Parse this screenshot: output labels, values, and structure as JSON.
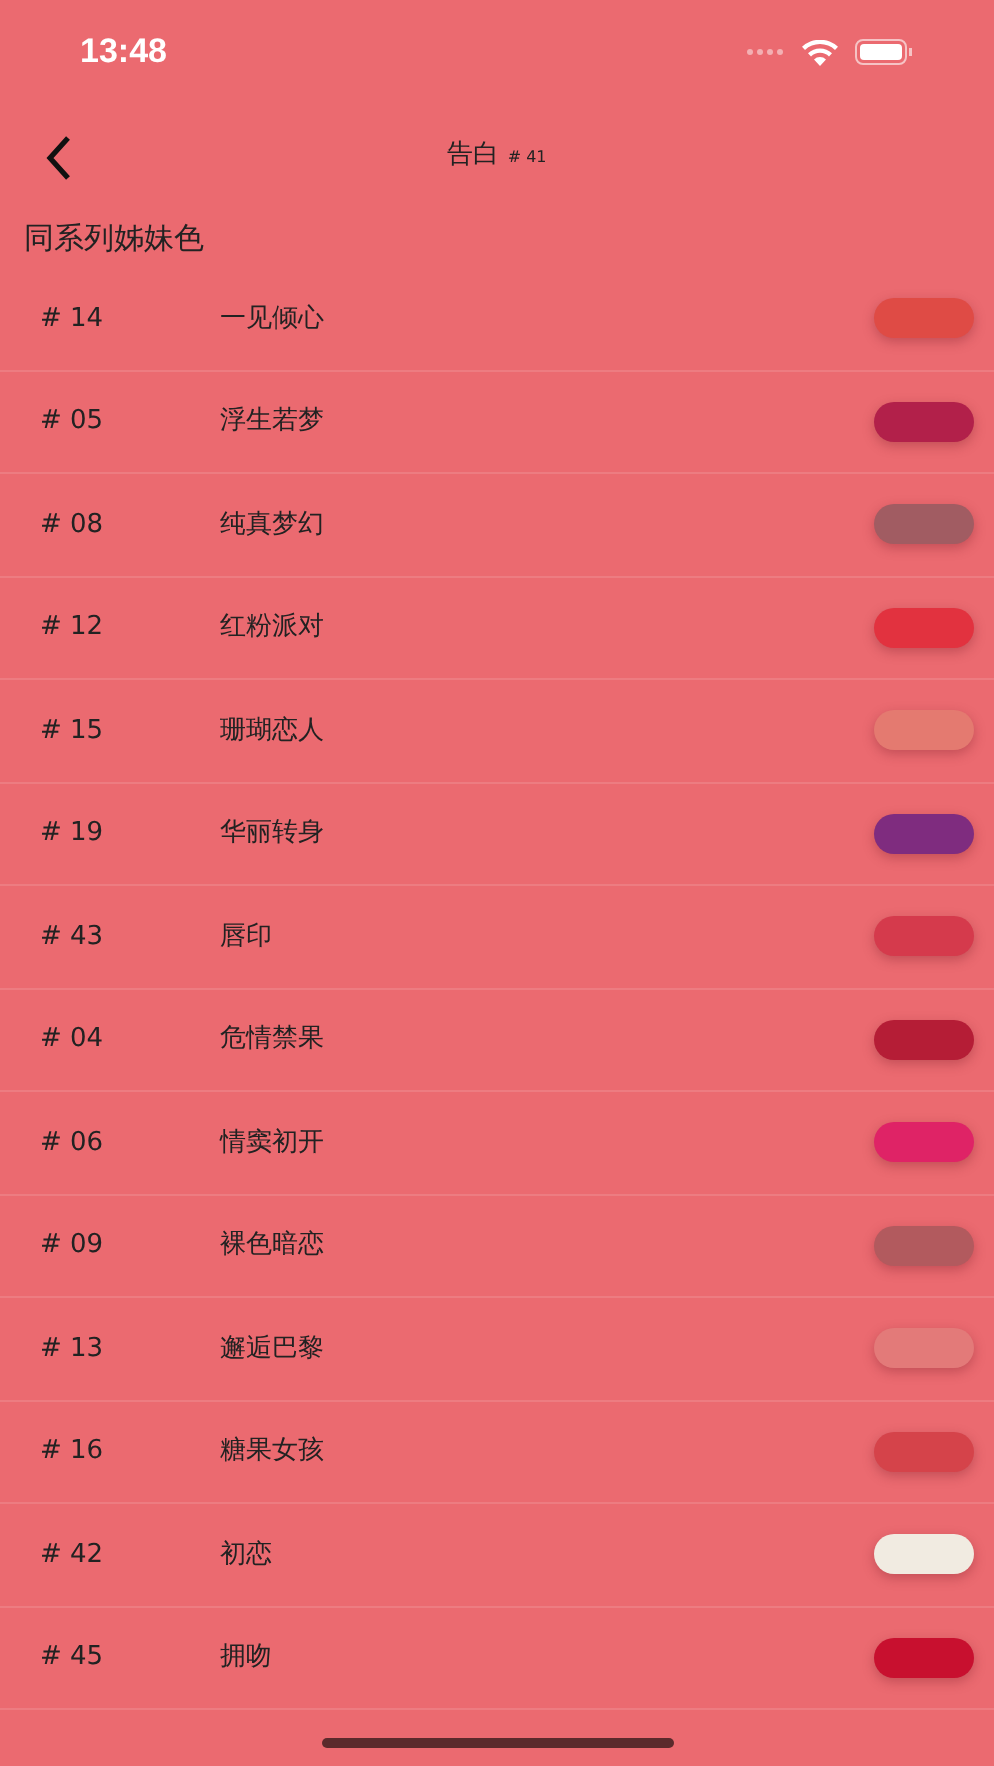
{
  "status_bar": {
    "time": "13:48"
  },
  "nav": {
    "title": "告白",
    "number": "# 41"
  },
  "section_title": "同系列姊妹色",
  "shades": [
    {
      "number": "# 14",
      "name": "一见倾心",
      "color": "#df4b45"
    },
    {
      "number": "# 05",
      "name": "浮生若梦",
      "color": "#b2204a"
    },
    {
      "number": "# 08",
      "name": "纯真梦幻",
      "color": "#a15c62"
    },
    {
      "number": "# 12",
      "name": "红粉派对",
      "color": "#e2323f"
    },
    {
      "number": "# 15",
      "name": "珊瑚恋人",
      "color": "#e47a70"
    },
    {
      "number": "# 19",
      "name": "华丽转身",
      "color": "#7f2c7f"
    },
    {
      "number": "# 43",
      "name": "唇印",
      "color": "#d53a4c"
    },
    {
      "number": "# 04",
      "name": "危情禁果",
      "color": "#b51d36"
    },
    {
      "number": "# 06",
      "name": "情窦初开",
      "color": "#df2366"
    },
    {
      "number": "# 09",
      "name": "裸色暗恋",
      "color": "#b25a5e"
    },
    {
      "number": "# 13",
      "name": "邂逅巴黎",
      "color": "#e37a79"
    },
    {
      "number": "# 16",
      "name": "糖果女孩",
      "color": "#d5434a"
    },
    {
      "number": "# 42",
      "name": "初恋",
      "color": "#f1ebe1"
    },
    {
      "number": "# 45",
      "name": "拥吻",
      "color": "#c8102f"
    }
  ]
}
